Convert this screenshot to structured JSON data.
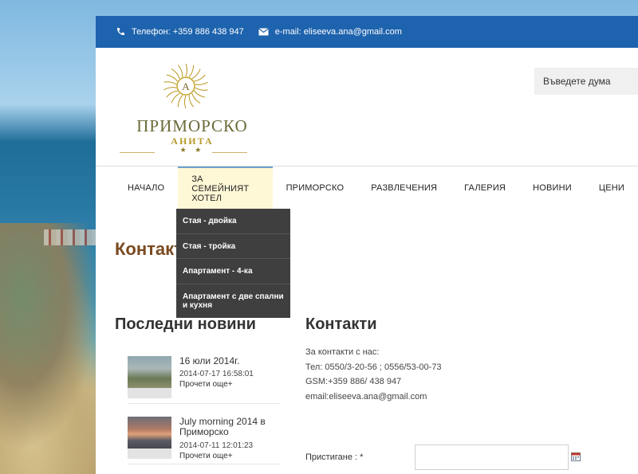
{
  "topbar": {
    "phone": "Телефон: +359 886 438 947",
    "email": "e-mail: eliseeva.ana@gmail.com",
    "phone_icon": "phone-icon",
    "email_icon": "envelope-icon"
  },
  "logo": {
    "letter": "А",
    "title": "ПРИМОРСКО",
    "subtitle": "АНИТА",
    "stars": "★ ★"
  },
  "search": {
    "placeholder": "Въведете дума"
  },
  "nav": {
    "items": [
      {
        "label": "НАЧАЛО"
      },
      {
        "label": "ЗА СЕМЕЙНИЯТ ХОТЕЛ"
      },
      {
        "label": "ПРИМОРСКО"
      },
      {
        "label": "РАЗВЛЕЧЕНИЯ"
      },
      {
        "label": "ГАЛЕРИЯ"
      },
      {
        "label": "НОВИНИ"
      },
      {
        "label": "ЦЕНИ"
      }
    ],
    "dropdown": [
      {
        "label": "Стая - двойка"
      },
      {
        "label": "Стая - тройка"
      },
      {
        "label": "Апартамент - 4-ка"
      },
      {
        "label": "Апартамент с две спални и кухня"
      }
    ]
  },
  "page_title": "Контакти",
  "news": {
    "heading": "Последни новини",
    "items": [
      {
        "title": "16 юли 2014г.",
        "date": "2014-07-17 16:58:01",
        "more": "Прочети още+"
      },
      {
        "title": "July morning 2014 в Приморско",
        "date": "2014-07-11 12:01:23",
        "more": "Прочети още+"
      }
    ]
  },
  "contacts": {
    "heading": "Контакти",
    "lines": [
      "За контакти с нас:",
      "Тел: 0550/3-20-56 ; 0556/53-00-73",
      "GSM:+359 886/ 438 947",
      "email:eliseeva.ana@gmail.com"
    ]
  },
  "form": {
    "arrival_label": "Пристигане : *",
    "arrival_value": "",
    "calendar_icon": "calendar-icon"
  },
  "colors": {
    "topbar": "#1e63ad",
    "nav_active": "#fff8d6",
    "dropdown": "#3f3f3f",
    "title_brown": "#7a4a20",
    "logo_gold": "#b59a2a"
  }
}
